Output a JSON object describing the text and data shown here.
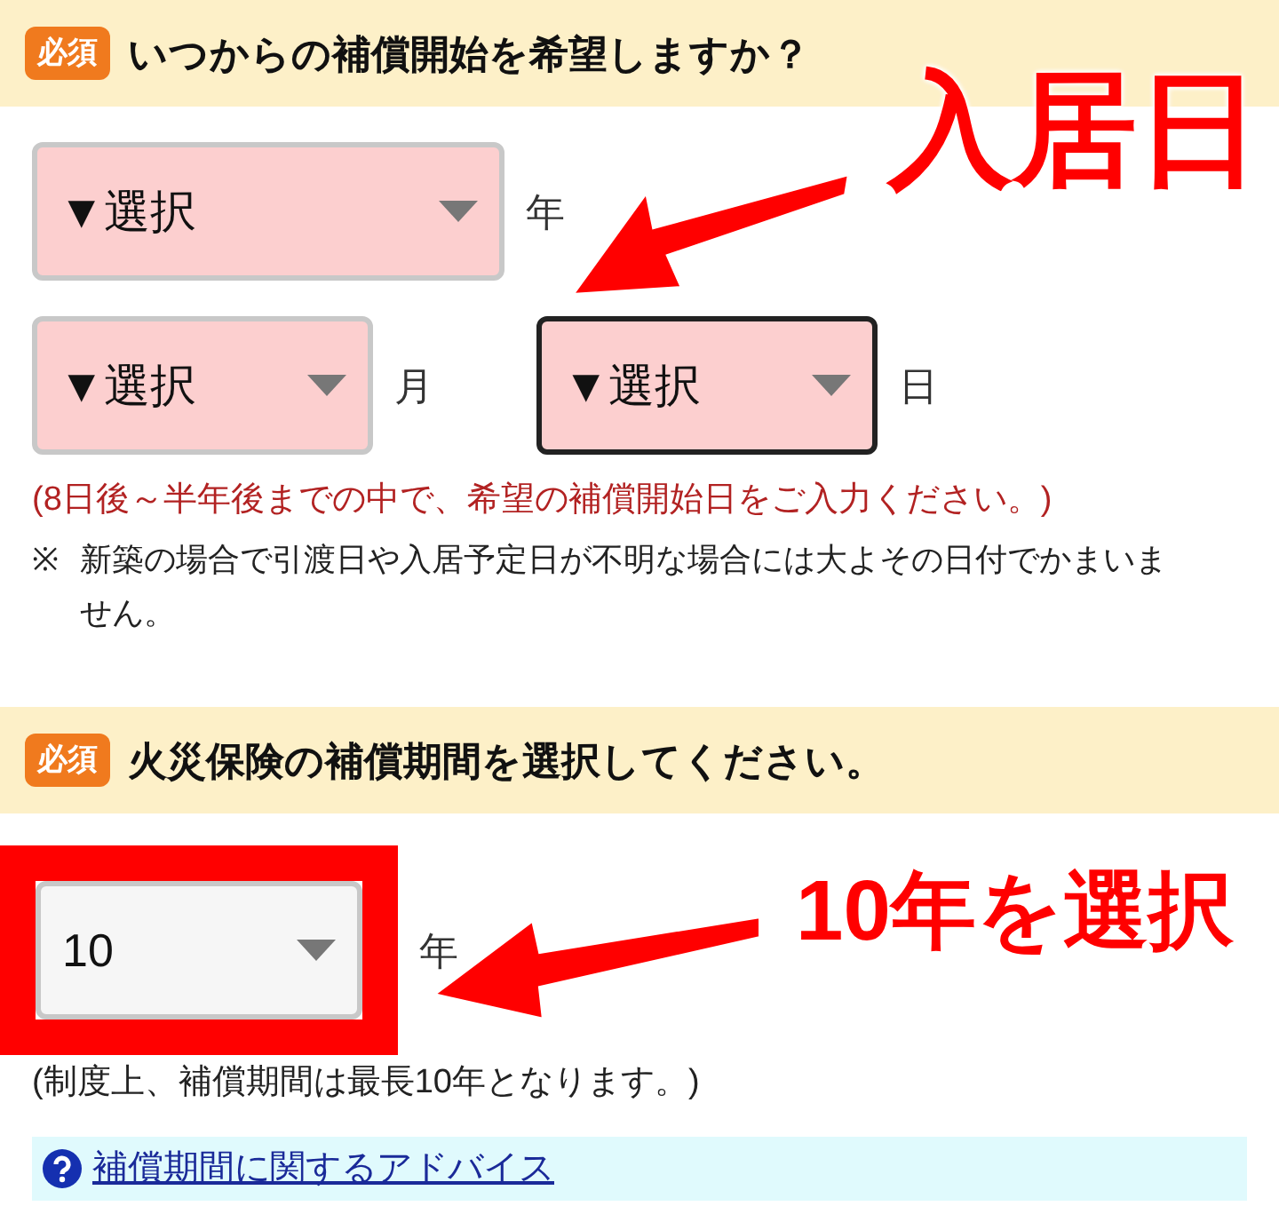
{
  "sections": [
    {
      "badge": "必須",
      "title": "いつからの補償開始を希望しますか？",
      "rows": [
        [
          {
            "value": "▼選択",
            "unit": "年",
            "empty": true,
            "focused": false,
            "highlighted": false
          }
        ],
        [
          {
            "value": "▼選択",
            "unit": "月",
            "empty": true,
            "focused": false,
            "highlighted": false
          },
          {
            "value": "▼選択",
            "unit": "日",
            "empty": true,
            "focused": true,
            "highlighted": false
          }
        ]
      ],
      "notes": [
        {
          "kind": "warning",
          "text": "(8日後～半年後までの中で、希望の補償開始日をご入力ください。)"
        },
        {
          "kind": "asterisk",
          "mark": "※",
          "text": "新築の場合で引渡日や入居予定日が不明な場合には大よその日付でかまいません。"
        }
      ]
    },
    {
      "badge": "必須",
      "title": "火災保険の補償期間を選択してください。",
      "rows": [
        [
          {
            "value": "10",
            "unit": "年",
            "empty": false,
            "focused": false,
            "highlighted": true
          }
        ]
      ],
      "notes": [
        {
          "kind": "plain",
          "text": "(制度上、補償期間は最長10年となります。)"
        }
      ],
      "advice_link": {
        "text": "補償期間に関するアドバイス"
      }
    }
  ],
  "annotations": [
    {
      "text": "入居日"
    },
    {
      "text": "10年を選択"
    }
  ]
}
